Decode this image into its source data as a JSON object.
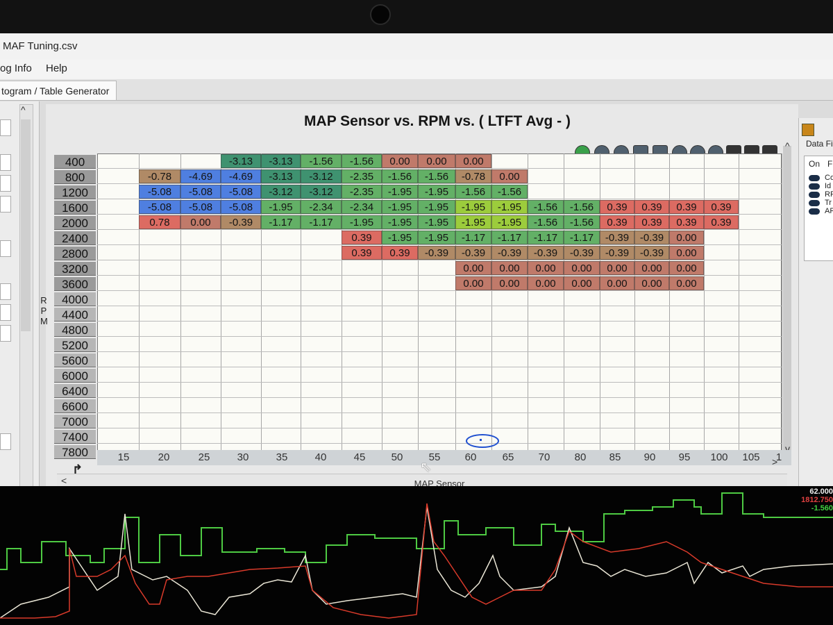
{
  "window": {
    "title": "MAF Tuning.csv"
  },
  "menu": [
    {
      "label": "og Info"
    },
    {
      "label": "Help"
    }
  ],
  "tab": {
    "label": "togram / Table Generator"
  },
  "chart": {
    "title": "MAP Sensor vs. RPM vs. ( LTFT Avg -   )",
    "y_axis_title": "RPM",
    "x_axis_title": "MAP Sensor",
    "corner_icon": "axis-swap-icon",
    "y_labels": [
      "400",
      "800",
      "1200",
      "1600",
      "2000",
      "2400",
      "2800",
      "3200",
      "3600",
      "4000",
      "4400",
      "4800",
      "5200",
      "5600",
      "6000",
      "6400",
      "6600",
      "7000",
      "7400",
      "7800"
    ],
    "x_labels": [
      "15",
      "20",
      "25",
      "30",
      "35",
      "40",
      "45",
      "50",
      "55",
      "60",
      "65",
      "70",
      "80",
      "85",
      "90",
      "95",
      "100",
      "105",
      "1"
    ],
    "colors": {
      "blue": "#4f7fe0",
      "dark_green": "#3f9270",
      "green": "#63b066",
      "lime": "#9ccc3c",
      "olive": "#b08a66",
      "brown": "#c07a6a",
      "red": "#dc6b62"
    },
    "rows": [
      [
        null,
        null,
        null,
        {
          "v": "-3.13",
          "c": "dark_green"
        },
        {
          "v": "-3.13",
          "c": "dark_green"
        },
        {
          "v": "-1.56",
          "c": "green"
        },
        {
          "v": "-1.56",
          "c": "green"
        },
        {
          "v": "0.00",
          "c": "brown"
        },
        {
          "v": "0.00",
          "c": "brown"
        },
        {
          "v": "0.00",
          "c": "brown"
        },
        null,
        null,
        null,
        null,
        null,
        null,
        null,
        null
      ],
      [
        null,
        {
          "v": "-0.78",
          "c": "olive"
        },
        {
          "v": "-4.69",
          "c": "blue"
        },
        {
          "v": "-4.69",
          "c": "blue"
        },
        {
          "v": "-3.13",
          "c": "dark_green"
        },
        {
          "v": "-3.12",
          "c": "dark_green"
        },
        {
          "v": "-2.35",
          "c": "green"
        },
        {
          "v": "-1.56",
          "c": "green"
        },
        {
          "v": "-1.56",
          "c": "green"
        },
        {
          "v": "-0.78",
          "c": "olive"
        },
        {
          "v": "0.00",
          "c": "brown"
        },
        null,
        null,
        null,
        null,
        null,
        null,
        null
      ],
      [
        null,
        {
          "v": "-5.08",
          "c": "blue"
        },
        {
          "v": "-5.08",
          "c": "blue"
        },
        {
          "v": "-5.08",
          "c": "blue"
        },
        {
          "v": "-3.12",
          "c": "dark_green"
        },
        {
          "v": "-3.12",
          "c": "dark_green"
        },
        {
          "v": "-2.35",
          "c": "green"
        },
        {
          "v": "-1.95",
          "c": "green"
        },
        {
          "v": "-1.95",
          "c": "green"
        },
        {
          "v": "-1.56",
          "c": "green"
        },
        {
          "v": "-1.56",
          "c": "green"
        },
        null,
        null,
        null,
        null,
        null,
        null,
        null
      ],
      [
        null,
        {
          "v": "-5.08",
          "c": "blue"
        },
        {
          "v": "-5.08",
          "c": "blue"
        },
        {
          "v": "-5.08",
          "c": "blue"
        },
        {
          "v": "-1.95",
          "c": "green"
        },
        {
          "v": "-2.34",
          "c": "green"
        },
        {
          "v": "-2.34",
          "c": "green"
        },
        {
          "v": "-1.95",
          "c": "green"
        },
        {
          "v": "-1.95",
          "c": "green"
        },
        {
          "v": "-1.95",
          "c": "lime"
        },
        {
          "v": "-1.95",
          "c": "lime"
        },
        {
          "v": "-1.56",
          "c": "green"
        },
        {
          "v": "-1.56",
          "c": "green"
        },
        {
          "v": "0.39",
          "c": "red"
        },
        {
          "v": "0.39",
          "c": "red"
        },
        {
          "v": "0.39",
          "c": "red"
        },
        {
          "v": "0.39",
          "c": "red"
        },
        null
      ],
      [
        null,
        {
          "v": "0.78",
          "c": "red"
        },
        {
          "v": "0.00",
          "c": "brown"
        },
        {
          "v": "-0.39",
          "c": "olive"
        },
        {
          "v": "-1.17",
          "c": "green"
        },
        {
          "v": "-1.17",
          "c": "green"
        },
        {
          "v": "-1.95",
          "c": "green"
        },
        {
          "v": "-1.95",
          "c": "green"
        },
        {
          "v": "-1.95",
          "c": "green"
        },
        {
          "v": "-1.95",
          "c": "lime"
        },
        {
          "v": "-1.95",
          "c": "lime"
        },
        {
          "v": "-1.56",
          "c": "green"
        },
        {
          "v": "-1.56",
          "c": "green"
        },
        {
          "v": "0.39",
          "c": "red"
        },
        {
          "v": "0.39",
          "c": "red"
        },
        {
          "v": "0.39",
          "c": "red"
        },
        {
          "v": "0.39",
          "c": "red"
        },
        null
      ],
      [
        null,
        null,
        null,
        null,
        null,
        null,
        {
          "v": "0.39",
          "c": "red"
        },
        {
          "v": "-1.95",
          "c": "green"
        },
        {
          "v": "-1.95",
          "c": "green"
        },
        {
          "v": "-1.17",
          "c": "green"
        },
        {
          "v": "-1.17",
          "c": "green"
        },
        {
          "v": "-1.17",
          "c": "green"
        },
        {
          "v": "-1.17",
          "c": "green"
        },
        {
          "v": "-0.39",
          "c": "olive"
        },
        {
          "v": "-0.39",
          "c": "olive"
        },
        {
          "v": "0.00",
          "c": "brown"
        },
        null,
        null
      ],
      [
        null,
        null,
        null,
        null,
        null,
        null,
        {
          "v": "0.39",
          "c": "red"
        },
        {
          "v": "0.39",
          "c": "red"
        },
        {
          "v": "-0.39",
          "c": "olive"
        },
        {
          "v": "-0.39",
          "c": "olive"
        },
        {
          "v": "-0.39",
          "c": "olive"
        },
        {
          "v": "-0.39",
          "c": "olive"
        },
        {
          "v": "-0.39",
          "c": "olive"
        },
        {
          "v": "-0.39",
          "c": "olive"
        },
        {
          "v": "-0.39",
          "c": "olive"
        },
        {
          "v": "0.00",
          "c": "brown"
        },
        null,
        null
      ],
      [
        null,
        null,
        null,
        null,
        null,
        null,
        null,
        null,
        null,
        {
          "v": "0.00",
          "c": "brown"
        },
        {
          "v": "0.00",
          "c": "brown"
        },
        {
          "v": "0.00",
          "c": "brown"
        },
        {
          "v": "0.00",
          "c": "brown"
        },
        {
          "v": "0.00",
          "c": "brown"
        },
        {
          "v": "0.00",
          "c": "brown"
        },
        {
          "v": "0.00",
          "c": "brown"
        },
        null,
        null
      ],
      [
        null,
        null,
        null,
        null,
        null,
        null,
        null,
        null,
        null,
        {
          "v": "0.00",
          "c": "brown"
        },
        {
          "v": "0.00",
          "c": "brown"
        },
        {
          "v": "0.00",
          "c": "brown"
        },
        {
          "v": "0.00",
          "c": "brown"
        },
        {
          "v": "0.00",
          "c": "brown"
        },
        {
          "v": "0.00",
          "c": "brown"
        },
        {
          "v": "0.00",
          "c": "brown"
        },
        null,
        null
      ]
    ]
  },
  "toolbar_icons": [
    "refresh-icon",
    "circle-icon",
    "equals-icon",
    "arrow-up-icon",
    "arrow-down-icon",
    "minus-icon",
    "plus-icon",
    "close-icon",
    "pencil-icon",
    "rows-icon",
    "columns-icon"
  ],
  "right_panel": {
    "title": "Data Fi",
    "header_on": "On",
    "header_f": "F",
    "items": [
      "Co",
      "Id",
      "RP",
      "Tr",
      "AF"
    ]
  },
  "graph": {
    "readouts": [
      {
        "value": "62.000",
        "color": "#f0f0f0"
      },
      {
        "value": "1812.750",
        "color": "#e04040"
      },
      {
        "value": "-1.560",
        "color": "#40d040"
      }
    ]
  }
}
